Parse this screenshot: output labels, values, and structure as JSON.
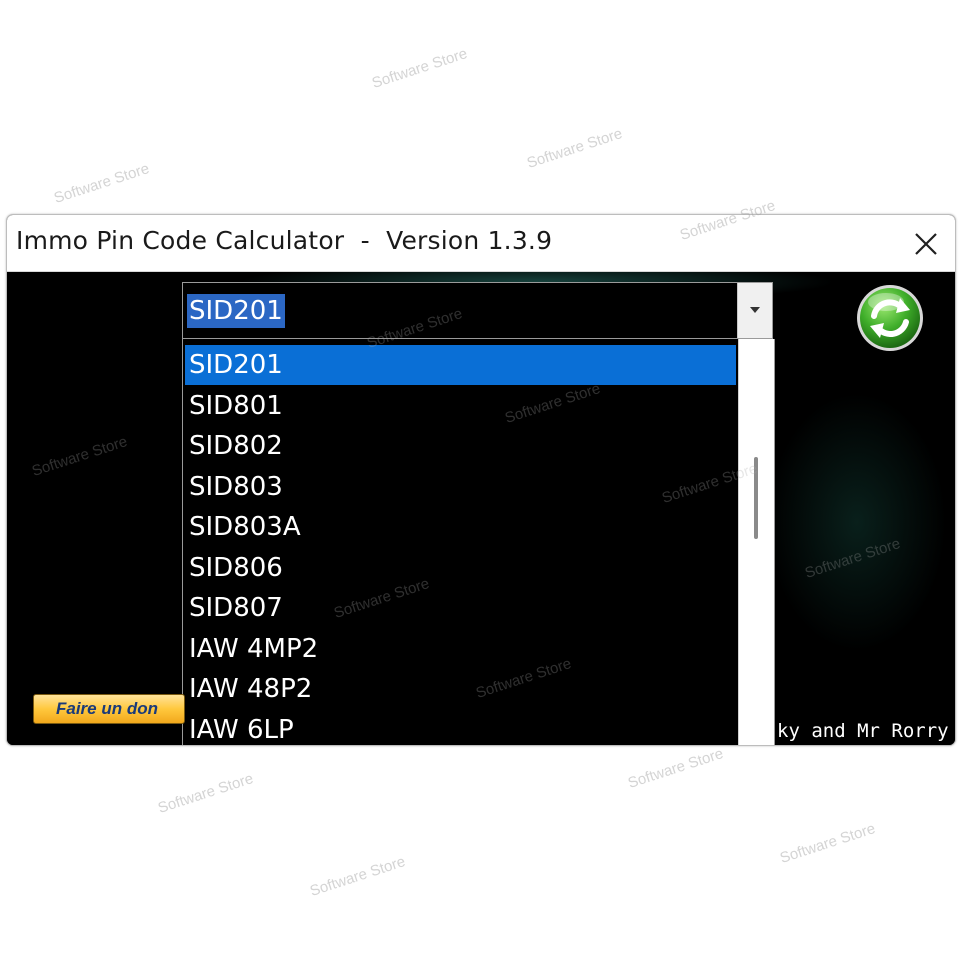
{
  "window": {
    "title": "Immo Pin Code Calculator  -  Version 1.3.9"
  },
  "combo": {
    "selected_value": "SID201"
  },
  "dropdown": {
    "options": [
      {
        "label": "SID201",
        "selected": true
      },
      {
        "label": "SID801",
        "selected": false
      },
      {
        "label": "SID802",
        "selected": false
      },
      {
        "label": "SID803",
        "selected": false
      },
      {
        "label": "SID803A",
        "selected": false
      },
      {
        "label": "SID806",
        "selected": false
      },
      {
        "label": "SID807",
        "selected": false
      },
      {
        "label": "IAW 4MP2",
        "selected": false
      },
      {
        "label": "IAW 48P2",
        "selected": false
      },
      {
        "label": "IAW 6LP",
        "selected": false
      }
    ]
  },
  "donate": {
    "label": "Faire un don"
  },
  "credits": {
    "text": "ky and Mr Rorry"
  },
  "watermark": {
    "text": "Software Store"
  },
  "icons": {
    "close": "close-icon",
    "dropdown_arrow": "chevron-down-icon",
    "refresh": "refresh-icon"
  },
  "colors": {
    "selection": "#0a6fd6",
    "combo_selection": "#2b67c4",
    "refresh_green": "#3fae2a",
    "donate_gold": "#ffc83d"
  }
}
